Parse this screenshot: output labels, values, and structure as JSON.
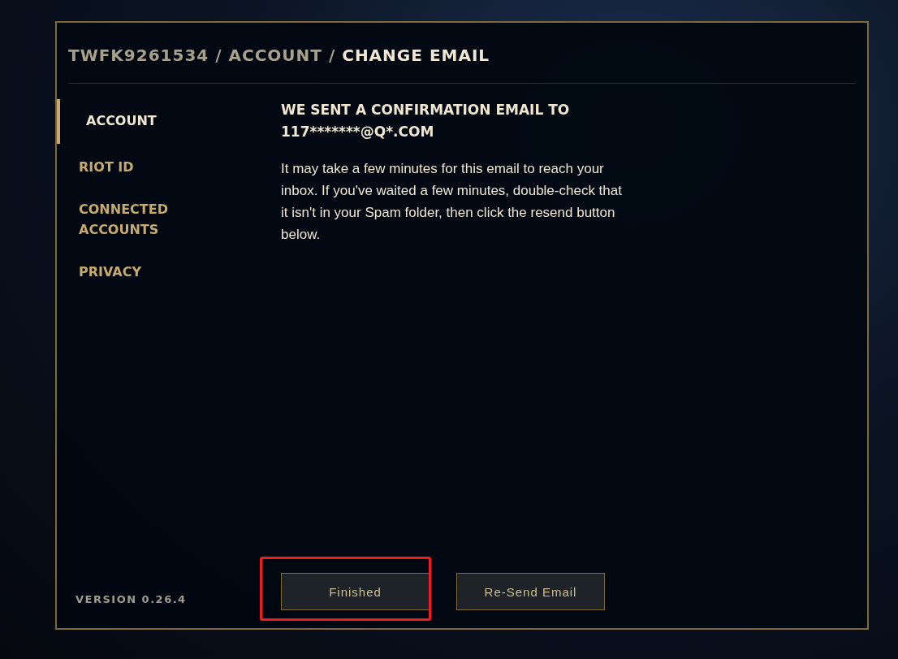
{
  "breadcrumb": "TWFK9261534 / ACCOUNT / **CHANGE EMAIL**",
  "sidebar": {
    "items": [
      {
        "label": "ACCOUNT",
        "selected": true
      },
      {
        "label": "RIOT ID",
        "selected": false
      },
      {
        "label": "CONNECTED ACCOUNTS",
        "selected": false
      },
      {
        "label": "PRIVACY",
        "selected": false
      }
    ],
    "version": "VERSION 0.26.4"
  },
  "content": {
    "heading": "WE SENT A CONFIRMATION EMAIL TO 117*******@Q*.COM",
    "message": "It may take a few minutes for this email to reach your inbox. If you've waited a few minutes, double-check that it isn't in your Spam folder, then click the resend button below."
  },
  "buttons": [
    {
      "label": "Finished",
      "highlighted": true
    },
    {
      "label": "Re-Send Email",
      "highlighted": false
    }
  ]
}
